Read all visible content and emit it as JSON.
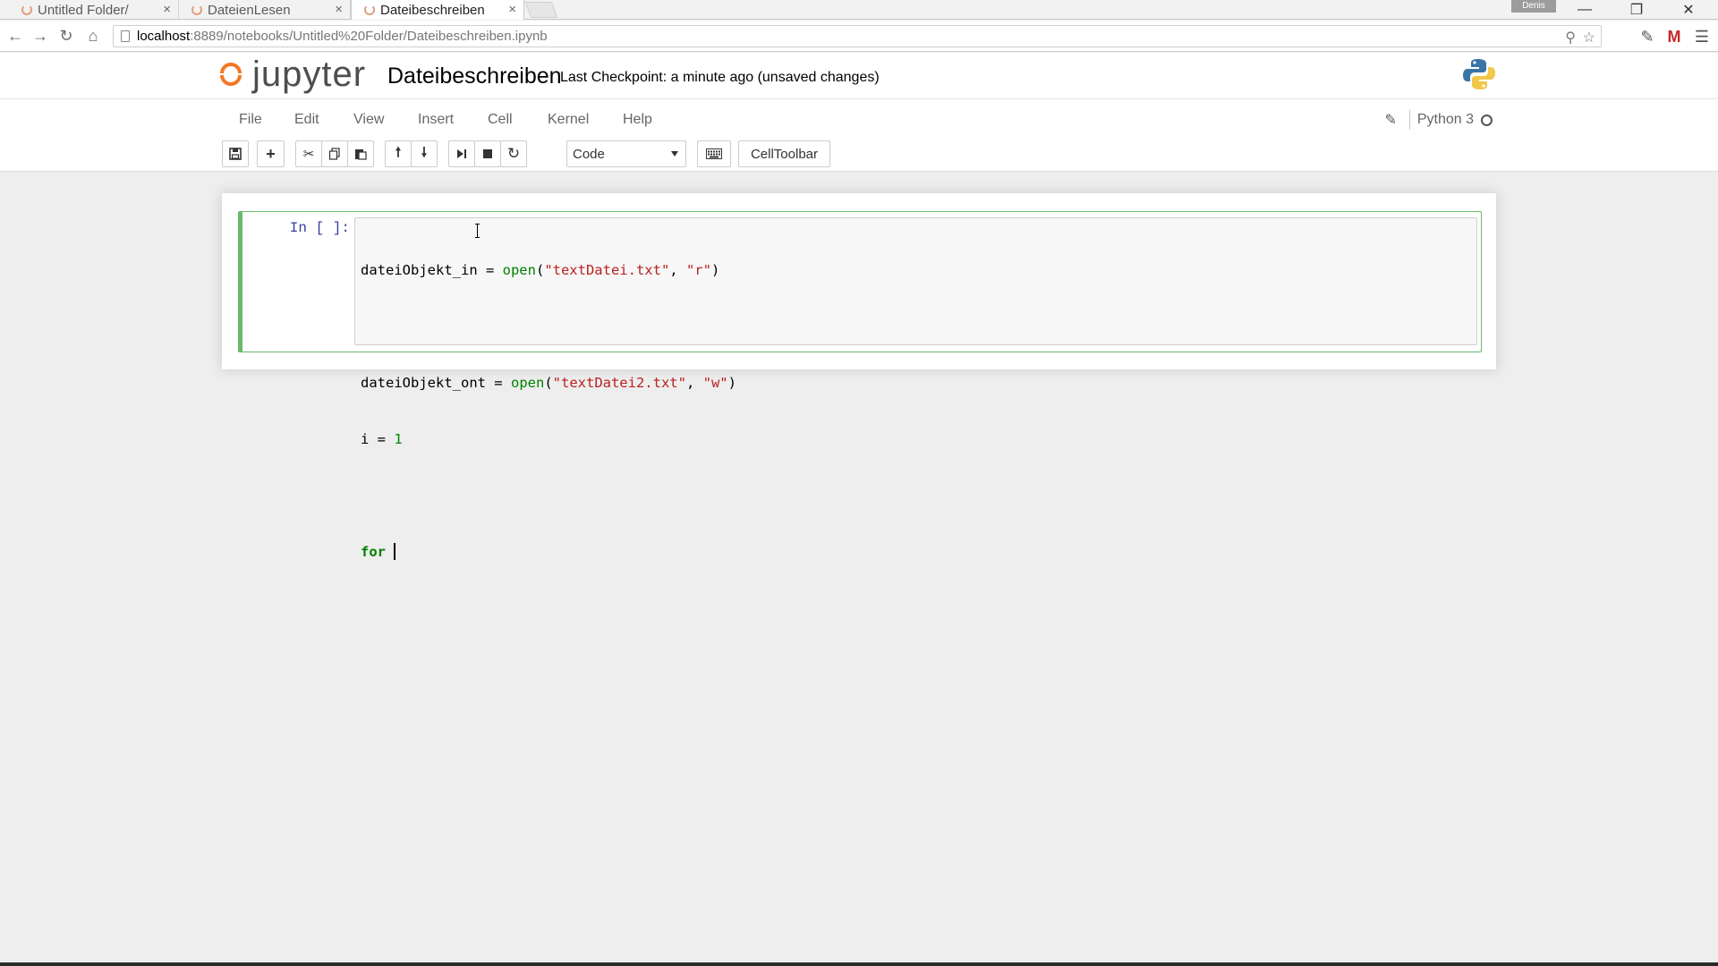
{
  "browser": {
    "tabs": [
      {
        "label": "Untitled Folder/",
        "active": false
      },
      {
        "label": "DateienLesen",
        "active": false
      },
      {
        "label": "Dateibeschreiben",
        "active": true
      }
    ],
    "tab_close_glyph": "×",
    "window_user": "Denis",
    "window_controls": {
      "minimize": "—",
      "restore": "❐",
      "close": "✕"
    },
    "url_host": "localhost",
    "url_path": ":8889/notebooks/Untitled%20Folder/Dateibeschreiben.ipynb",
    "nav_icons": [
      "back-arrow-icon",
      "forward-arrow-icon",
      "reload-icon",
      "home-icon"
    ]
  },
  "header": {
    "logo_text": "jupyter",
    "notebook_name": "Dateibeschreiben",
    "checkpoint": "Last Checkpoint: a minute ago (unsaved changes)"
  },
  "menubar": {
    "items": [
      "File",
      "Edit",
      "View",
      "Insert",
      "Cell",
      "Kernel",
      "Help"
    ],
    "kernel_name": "Python 3"
  },
  "toolbar": {
    "cell_type": "Code",
    "celltoolbar_label": "CellToolbar"
  },
  "cell": {
    "prompt": "In [ ]:",
    "code_lines": [
      "dateiObjekt_in = open(\"textDatei.txt\", \"r\")",
      "",
      "dateiObjekt_ont = open(\"textDatei2.txt\", \"w\")",
      "i = 1",
      "",
      "for "
    ]
  },
  "colors": {
    "accent_orange": "#f37726",
    "cell_border_edit": "#66bb6a",
    "prompt_blue": "#303f9f",
    "keyword_green": "#008000",
    "string_red": "#ba2121"
  }
}
